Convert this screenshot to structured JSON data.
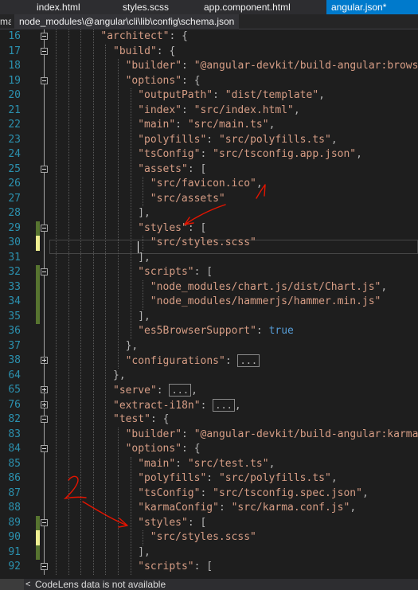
{
  "tabs": [
    {
      "label": "index.html",
      "active": false
    },
    {
      "label": "styles.scss",
      "active": false
    },
    {
      "label": "app.component.html",
      "active": false
    },
    {
      "label": "angular.json*",
      "active": true
    }
  ],
  "schema": {
    "left_fragment": "ma:",
    "path": "node_modules\\@angular\\cli\\lib\\config\\schema.json"
  },
  "editor": {
    "lines": [
      {
        "num": "16",
        "indent": 4,
        "fold": "open",
        "change": "none",
        "tokens": [
          [
            "k",
            "\"architect\""
          ],
          [
            "p",
            ": {"
          ]
        ]
      },
      {
        "num": "17",
        "indent": 5,
        "fold": "open",
        "change": "none",
        "tokens": [
          [
            "k",
            "\"build\""
          ],
          [
            "p",
            ": {"
          ]
        ]
      },
      {
        "num": "18",
        "indent": 6,
        "fold": "none",
        "change": "none",
        "tokens": [
          [
            "k",
            "\"builder\""
          ],
          [
            "p",
            ": "
          ],
          [
            "s",
            "\"@angular-devkit/build-angular:browser\""
          ]
        ]
      },
      {
        "num": "19",
        "indent": 6,
        "fold": "open",
        "change": "none",
        "tokens": [
          [
            "k",
            "\"options\""
          ],
          [
            "p",
            ": {"
          ]
        ]
      },
      {
        "num": "20",
        "indent": 7,
        "fold": "none",
        "change": "none",
        "tokens": [
          [
            "k",
            "\"outputPath\""
          ],
          [
            "p",
            ": "
          ],
          [
            "s",
            "\"dist/template\""
          ],
          [
            "p",
            ","
          ]
        ]
      },
      {
        "num": "21",
        "indent": 7,
        "fold": "none",
        "change": "none",
        "tokens": [
          [
            "k",
            "\"index\""
          ],
          [
            "p",
            ": "
          ],
          [
            "s",
            "\"src/index.html\""
          ],
          [
            "p",
            ","
          ]
        ]
      },
      {
        "num": "22",
        "indent": 7,
        "fold": "none",
        "change": "none",
        "tokens": [
          [
            "k",
            "\"main\""
          ],
          [
            "p",
            ": "
          ],
          [
            "s",
            "\"src/main.ts\""
          ],
          [
            "p",
            ","
          ]
        ]
      },
      {
        "num": "23",
        "indent": 7,
        "fold": "none",
        "change": "none",
        "tokens": [
          [
            "k",
            "\"polyfills\""
          ],
          [
            "p",
            ": "
          ],
          [
            "s",
            "\"src/polyfills.ts\""
          ],
          [
            "p",
            ","
          ]
        ]
      },
      {
        "num": "24",
        "indent": 7,
        "fold": "none",
        "change": "none",
        "tokens": [
          [
            "k",
            "\"tsConfig\""
          ],
          [
            "p",
            ": "
          ],
          [
            "s",
            "\"src/tsconfig.app.json\""
          ],
          [
            "p",
            ","
          ]
        ]
      },
      {
        "num": "25",
        "indent": 7,
        "fold": "open",
        "change": "none",
        "tokens": [
          [
            "k",
            "\"assets\""
          ],
          [
            "p",
            ": ["
          ]
        ]
      },
      {
        "num": "26",
        "indent": 8,
        "fold": "none",
        "change": "none",
        "tokens": [
          [
            "s",
            "\"src/favicon.ico\""
          ],
          [
            "p",
            ","
          ]
        ]
      },
      {
        "num": "27",
        "indent": 8,
        "fold": "none",
        "change": "none",
        "tokens": [
          [
            "s",
            "\"src/assets\""
          ]
        ]
      },
      {
        "num": "28",
        "indent": 7,
        "fold": "none",
        "change": "none",
        "tokens": [
          [
            "p",
            "],"
          ]
        ]
      },
      {
        "num": "29",
        "indent": 7,
        "fold": "open",
        "change": "saved",
        "tokens": [
          [
            "k",
            "\"styles\""
          ],
          [
            "p",
            ": ["
          ]
        ]
      },
      {
        "num": "30",
        "indent": 8,
        "fold": "none",
        "change": "unsaved",
        "tokens": [
          [
            "s",
            "\"src/styles.scss\""
          ]
        ]
      },
      {
        "num": "31",
        "indent": 7,
        "fold": "none",
        "change": "none",
        "tokens": [
          [
            "p",
            "],"
          ]
        ]
      },
      {
        "num": "32",
        "indent": 7,
        "fold": "open",
        "change": "saved",
        "tokens": [
          [
            "k",
            "\"scripts\""
          ],
          [
            "p",
            ": ["
          ]
        ]
      },
      {
        "num": "33",
        "indent": 8,
        "fold": "none",
        "change": "saved",
        "tokens": [
          [
            "s",
            "\"node_modules/chart.js/dist/Chart.js\""
          ],
          [
            "p",
            ","
          ]
        ]
      },
      {
        "num": "34",
        "indent": 8,
        "fold": "none",
        "change": "saved",
        "tokens": [
          [
            "s",
            "\"node_modules/hammerjs/hammer.min.js\""
          ]
        ]
      },
      {
        "num": "35",
        "indent": 7,
        "fold": "none",
        "change": "saved",
        "tokens": [
          [
            "p",
            "],"
          ]
        ]
      },
      {
        "num": "36",
        "indent": 7,
        "fold": "none",
        "change": "none",
        "tokens": [
          [
            "k",
            "\"es5BrowserSupport\""
          ],
          [
            "p",
            ": "
          ],
          [
            "b",
            "true"
          ]
        ]
      },
      {
        "num": "37",
        "indent": 6,
        "fold": "none",
        "change": "none",
        "tokens": [
          [
            "p",
            "},"
          ]
        ]
      },
      {
        "num": "38",
        "indent": 6,
        "fold": "closed",
        "change": "none",
        "tokens": [
          [
            "k",
            "\"configurations\""
          ],
          [
            "p",
            ": "
          ],
          [
            "e",
            "..."
          ]
        ]
      },
      {
        "num": "64",
        "indent": 5,
        "fold": "none",
        "change": "none",
        "tokens": [
          [
            "p",
            "},"
          ]
        ]
      },
      {
        "num": "65",
        "indent": 5,
        "fold": "closed",
        "change": "none",
        "tokens": [
          [
            "k",
            "\"serve\""
          ],
          [
            "p",
            ": "
          ],
          [
            "e",
            "..."
          ],
          [
            "p",
            ","
          ]
        ]
      },
      {
        "num": "76",
        "indent": 5,
        "fold": "closed",
        "change": "none",
        "tokens": [
          [
            "k",
            "\"extract-i18n\""
          ],
          [
            "p",
            ": "
          ],
          [
            "e",
            "..."
          ],
          [
            "p",
            ","
          ]
        ]
      },
      {
        "num": "82",
        "indent": 5,
        "fold": "open",
        "change": "none",
        "tokens": [
          [
            "k",
            "\"test\""
          ],
          [
            "p",
            ": {"
          ]
        ]
      },
      {
        "num": "83",
        "indent": 6,
        "fold": "none",
        "change": "none",
        "tokens": [
          [
            "k",
            "\"builder\""
          ],
          [
            "p",
            ": "
          ],
          [
            "s",
            "\"@angular-devkit/build-angular:karma\""
          ],
          [
            "p",
            ","
          ]
        ]
      },
      {
        "num": "84",
        "indent": 6,
        "fold": "open",
        "change": "none",
        "tokens": [
          [
            "k",
            "\"options\""
          ],
          [
            "p",
            ": {"
          ]
        ]
      },
      {
        "num": "85",
        "indent": 7,
        "fold": "none",
        "change": "none",
        "tokens": [
          [
            "k",
            "\"main\""
          ],
          [
            "p",
            ": "
          ],
          [
            "s",
            "\"src/test.ts\""
          ],
          [
            "p",
            ","
          ]
        ]
      },
      {
        "num": "86",
        "indent": 7,
        "fold": "none",
        "change": "none",
        "tokens": [
          [
            "k",
            "\"polyfills\""
          ],
          [
            "p",
            ": "
          ],
          [
            "s",
            "\"src/polyfills.ts\""
          ],
          [
            "p",
            ","
          ]
        ]
      },
      {
        "num": "87",
        "indent": 7,
        "fold": "none",
        "change": "none",
        "tokens": [
          [
            "k",
            "\"tsConfig\""
          ],
          [
            "p",
            ": "
          ],
          [
            "s",
            "\"src/tsconfig.spec.json\""
          ],
          [
            "p",
            ","
          ]
        ]
      },
      {
        "num": "88",
        "indent": 7,
        "fold": "none",
        "change": "none",
        "tokens": [
          [
            "k",
            "\"karmaConfig\""
          ],
          [
            "p",
            ": "
          ],
          [
            "s",
            "\"src/karma.conf.js\""
          ],
          [
            "p",
            ","
          ]
        ]
      },
      {
        "num": "89",
        "indent": 7,
        "fold": "open",
        "change": "saved",
        "tokens": [
          [
            "k",
            "\"styles\""
          ],
          [
            "p",
            ": ["
          ]
        ]
      },
      {
        "num": "90",
        "indent": 8,
        "fold": "none",
        "change": "unsaved",
        "tokens": [
          [
            "s",
            "\"src/styles.scss\""
          ]
        ]
      },
      {
        "num": "91",
        "indent": 7,
        "fold": "none",
        "change": "saved",
        "tokens": [
          [
            "p",
            "],"
          ]
        ]
      },
      {
        "num": "92",
        "indent": 7,
        "fold": "open",
        "change": "none",
        "tokens": [
          [
            "k",
            "\"scripts\""
          ],
          [
            "p",
            ": ["
          ]
        ]
      }
    ]
  },
  "annotations": {
    "label_1": "1",
    "label_2": "2",
    "color": "#e51400"
  },
  "status": {
    "codelens_text": "CodeLens data is not available",
    "codelens_icon": "chevron-left-icon"
  }
}
